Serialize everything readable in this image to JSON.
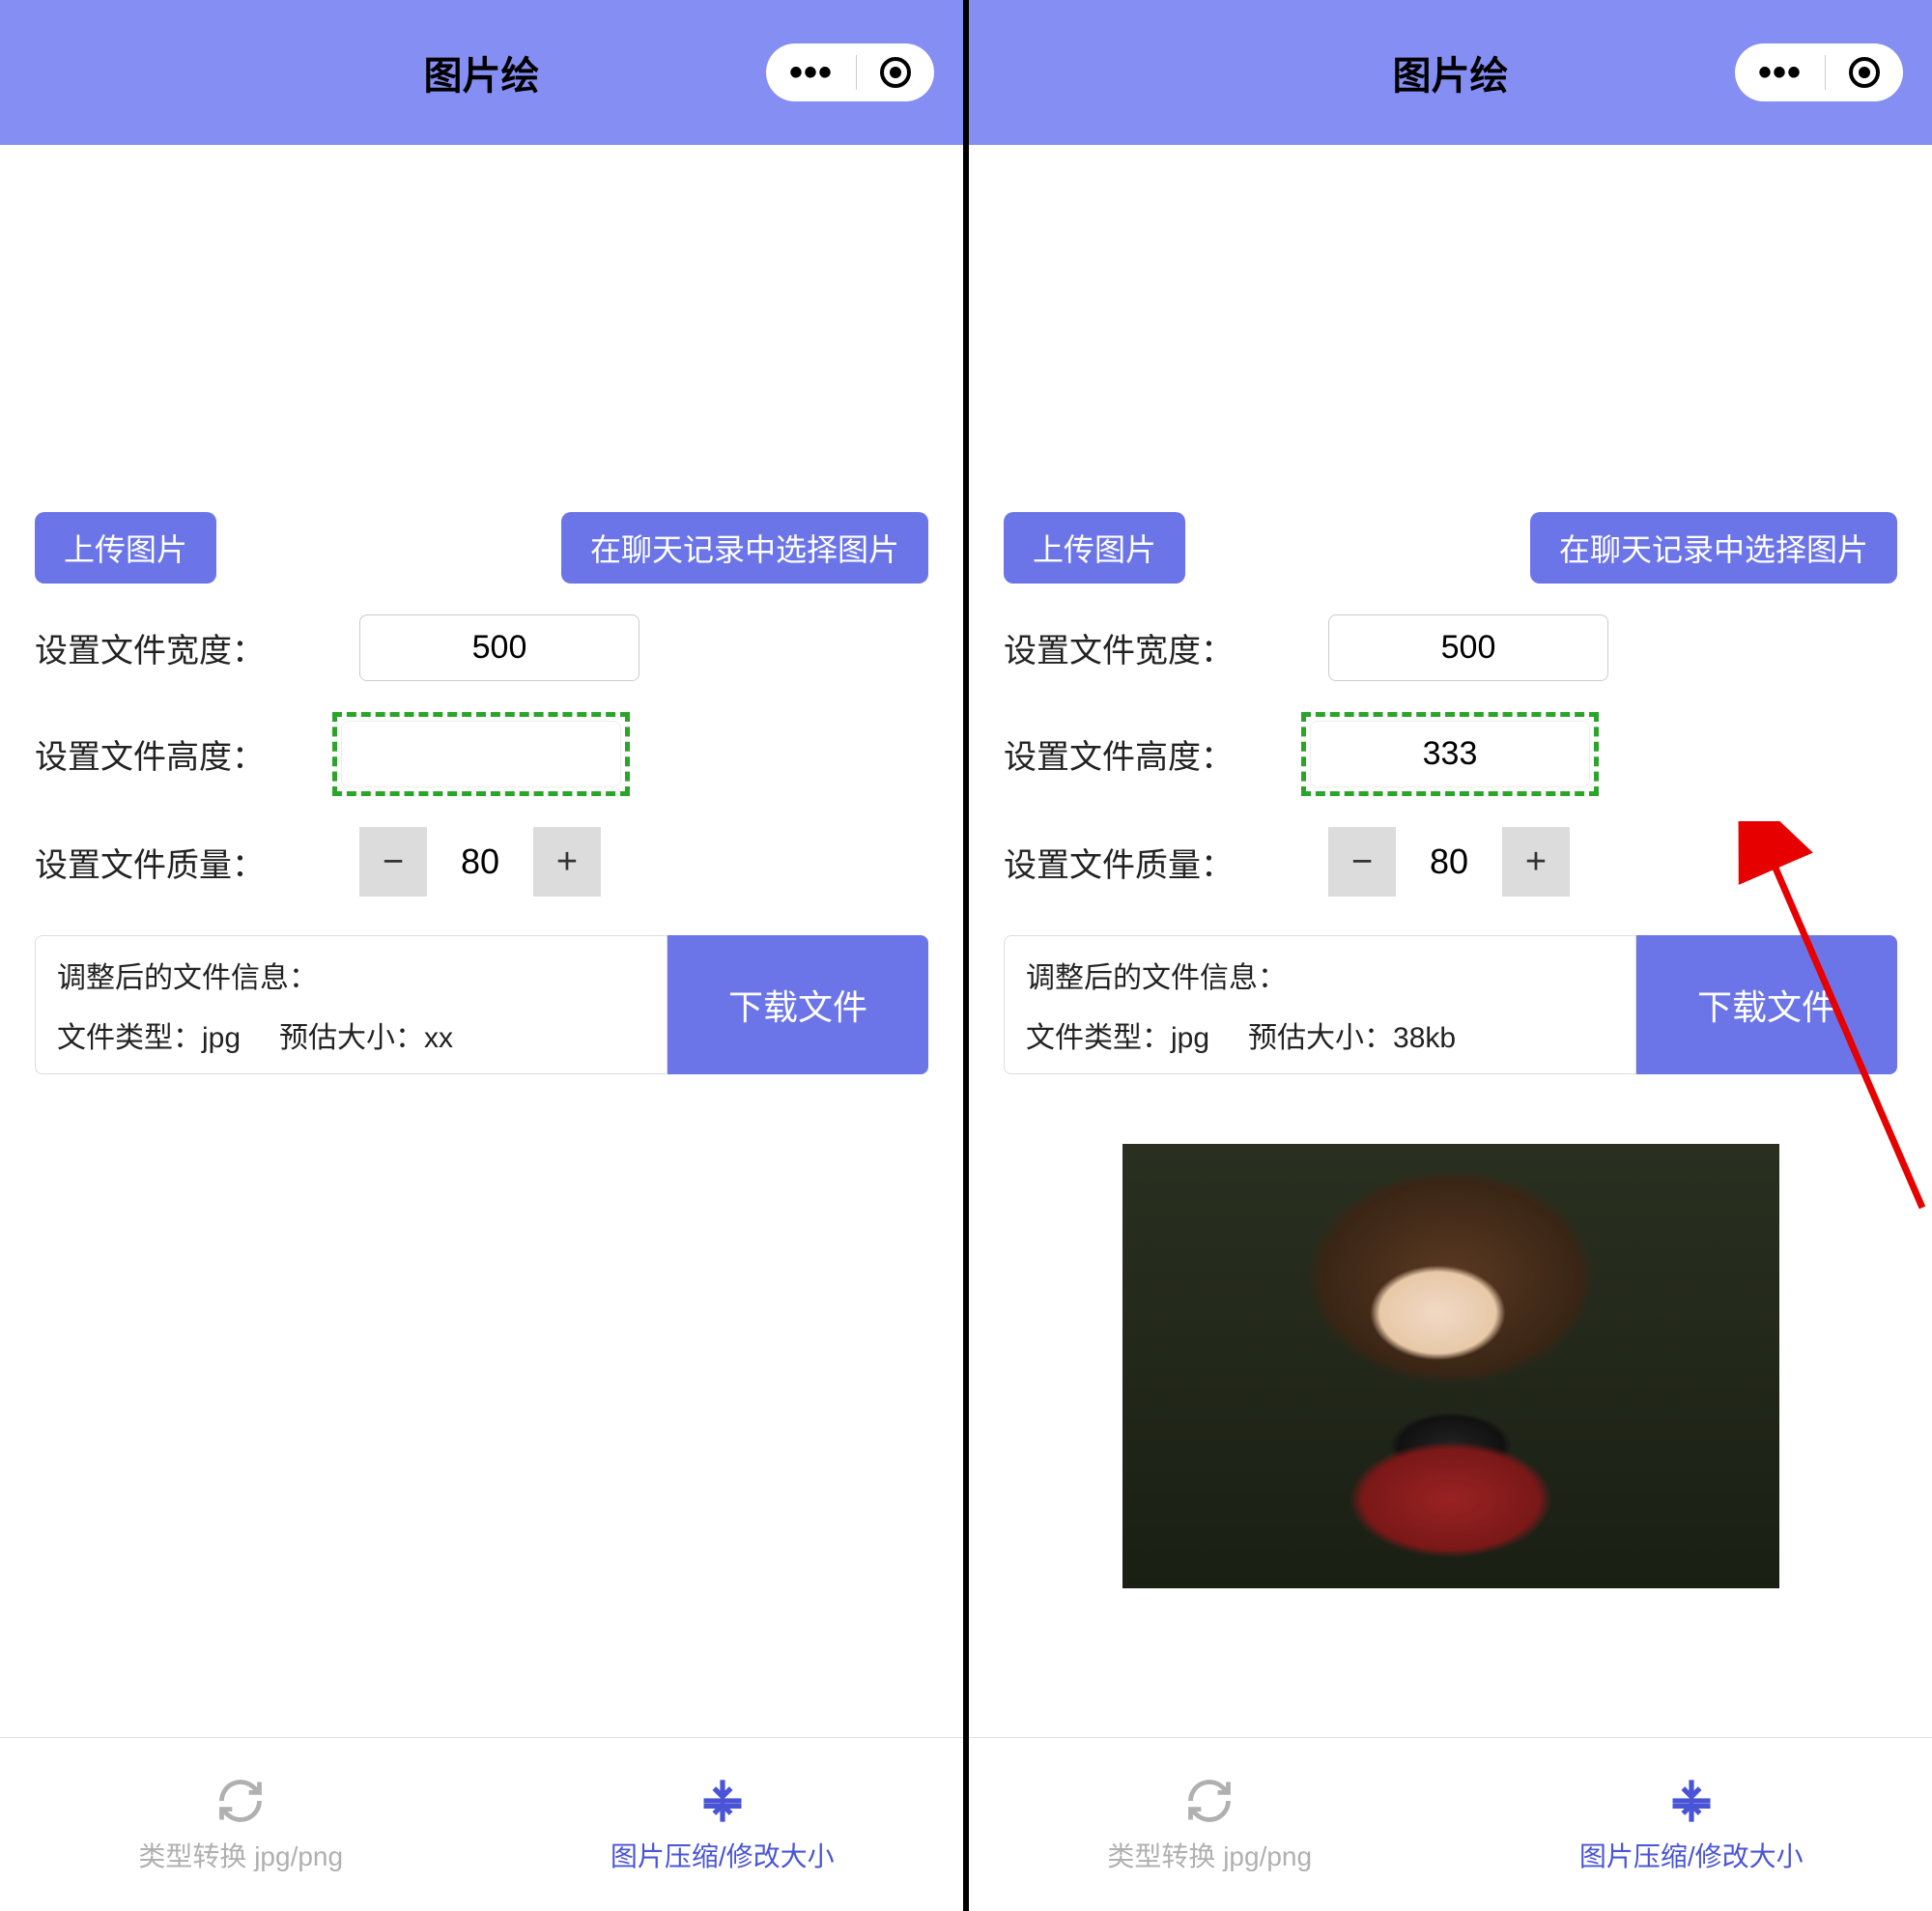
{
  "left": {
    "header": {
      "title": "图片绘"
    },
    "buttons": {
      "upload": "上传图片",
      "select_chat": "在聊天记录中选择图片"
    },
    "labels": {
      "width": "设置文件宽度：",
      "height": "设置文件高度：",
      "quality": "设置文件质量："
    },
    "values": {
      "width": "500",
      "height": "",
      "quality": "80"
    },
    "info": {
      "title": "调整后的文件信息：",
      "type_label": "文件类型：",
      "type_value": "jpg",
      "size_label": "预估大小：",
      "size_value": "xx"
    },
    "download": "下载文件",
    "tabs": {
      "convert": "类型转换 jpg/png",
      "compress": "图片压缩/修改大小"
    }
  },
  "right": {
    "header": {
      "title": "图片绘"
    },
    "buttons": {
      "upload": "上传图片",
      "select_chat": "在聊天记录中选择图片"
    },
    "labels": {
      "width": "设置文件宽度：",
      "height": "设置文件高度：",
      "quality": "设置文件质量："
    },
    "values": {
      "width": "500",
      "height": "333",
      "quality": "80"
    },
    "info": {
      "title": "调整后的文件信息：",
      "type_label": "文件类型：",
      "type_value": "jpg",
      "size_label": "预估大小：",
      "size_value": "38kb"
    },
    "download": "下载文件",
    "tabs": {
      "convert": "类型转换 jpg/png",
      "compress": "图片压缩/修改大小"
    }
  }
}
